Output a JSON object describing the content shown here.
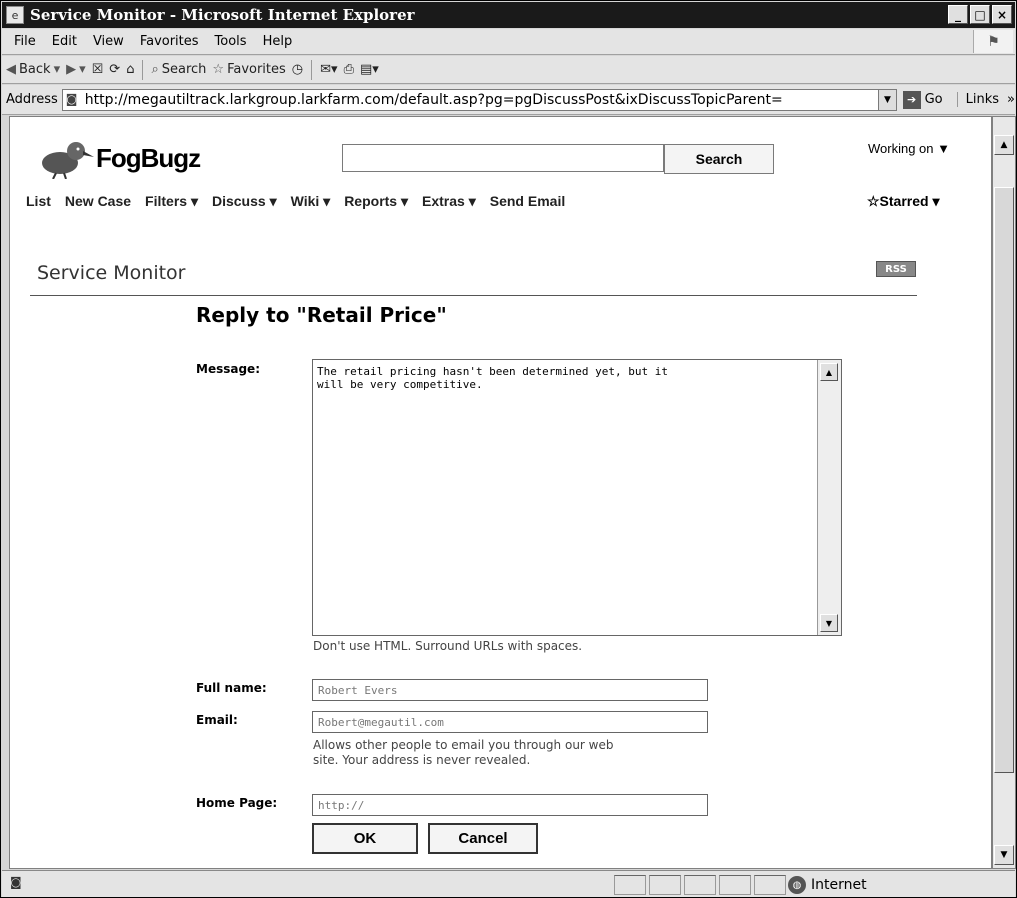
{
  "window": {
    "title": "Service Monitor - Microsoft Internet Explorer",
    "buttons": [
      "_",
      "□",
      "×"
    ]
  },
  "menubar": {
    "items": [
      "File",
      "Edit",
      "View",
      "Favorites",
      "Tools",
      "Help"
    ]
  },
  "toolbar": {
    "back": "Back",
    "search": "Search",
    "favorites": "Favorites"
  },
  "addressbar": {
    "label": "Address",
    "url": "http://megautiltrack.larkgroup.larkfarm.com/default.asp?pg=pgDiscussPost&ixDiscussTopicParent=",
    "go": "Go",
    "links": "Links",
    "chevron": "»"
  },
  "app": {
    "logo_text": "FogBugz",
    "search_button": "Search",
    "working_on": "Working on ▼",
    "nav": [
      "List",
      "New Case",
      "Filters ▾",
      "Discuss ▾",
      "Wiki ▾",
      "Reports ▾",
      "Extras ▾",
      "Send Email"
    ],
    "starred": "☆Starred ▾",
    "project_title": "Service Monitor",
    "rss": "RSS"
  },
  "form": {
    "heading": "Reply to \"Retail Price\"",
    "message_label": "Message:",
    "message_value": "The retail pricing hasn't been determined yet, but it\nwill be very competitive.",
    "message_hint": "Don't use HTML. Surround URLs with spaces.",
    "fullname_label": "Full name:",
    "fullname_value": "Robert Evers",
    "email_label": "Email:",
    "email_value": "Robert@megautil.com",
    "email_hint_1": "Allows other people to email you through our web",
    "email_hint_2": "site. Your address is never revealed.",
    "homepage_label": "Home Page:",
    "homepage_value": "http://",
    "ok": "OK",
    "cancel": "Cancel"
  },
  "statusbar": {
    "zone": "Internet"
  }
}
